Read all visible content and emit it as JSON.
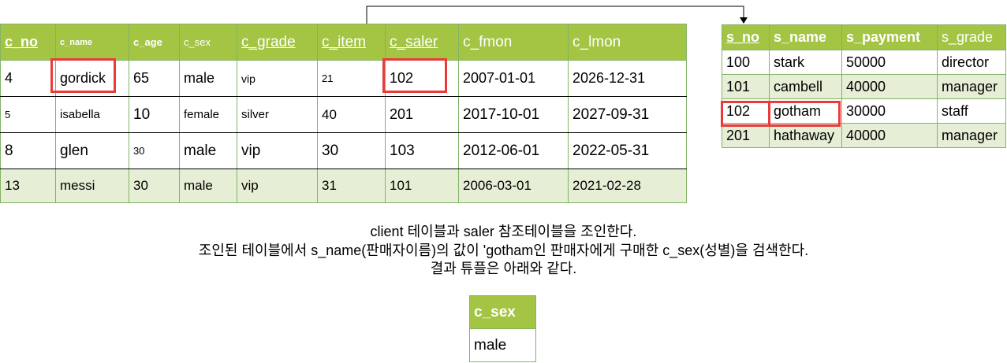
{
  "client_table": {
    "headers": [
      "c_no",
      "c_name",
      "c_age",
      "c_sex",
      "c_grade",
      "c_item",
      "c_saler",
      "c_fmon",
      "c_lmon"
    ],
    "rows": [
      [
        "4",
        "gordick",
        "65",
        "male",
        "vip",
        "21",
        "102",
        "2007-01-01",
        "2026-12-31"
      ],
      [
        "5",
        "isabella",
        "10",
        "female",
        "silver",
        "40",
        "201",
        "2017-10-01",
        "2027-09-31"
      ],
      [
        "8",
        "glen",
        "30",
        "male",
        "vip",
        "30",
        "103",
        "2012-06-01",
        "2022-05-31"
      ],
      [
        "13",
        "messi",
        "30",
        "male",
        "vip",
        "31",
        "101",
        "2006-03-01",
        "2021-02-28"
      ]
    ]
  },
  "saler_table": {
    "headers": [
      "s_no",
      "s_name",
      "s_payment",
      "s_grade"
    ],
    "rows": [
      [
        "100",
        "stark",
        "50000",
        "director"
      ],
      [
        "101",
        "cambell",
        "40000",
        "manager"
      ],
      [
        "102",
        "gotham",
        "30000",
        "staff"
      ],
      [
        "201",
        "hathaway",
        "40000",
        "manager"
      ]
    ]
  },
  "caption": {
    "line1": "client 테이블과 saler 참조테이블을 조인한다.",
    "line2": "조인된 테이블에서 s_name(판매자이름)의 값이 'gotham인 판매자에게  구매한 c_sex(성별)을 검색한다.",
    "line3": "결과 튜플은 아래와 같다."
  },
  "result_table": {
    "header": "c_sex",
    "value": "male"
  },
  "colors": {
    "header_bg": "#a4c444",
    "alt_row_bg": "#e6efd6",
    "border": "#82b366",
    "highlight": "#ea3b3b"
  }
}
